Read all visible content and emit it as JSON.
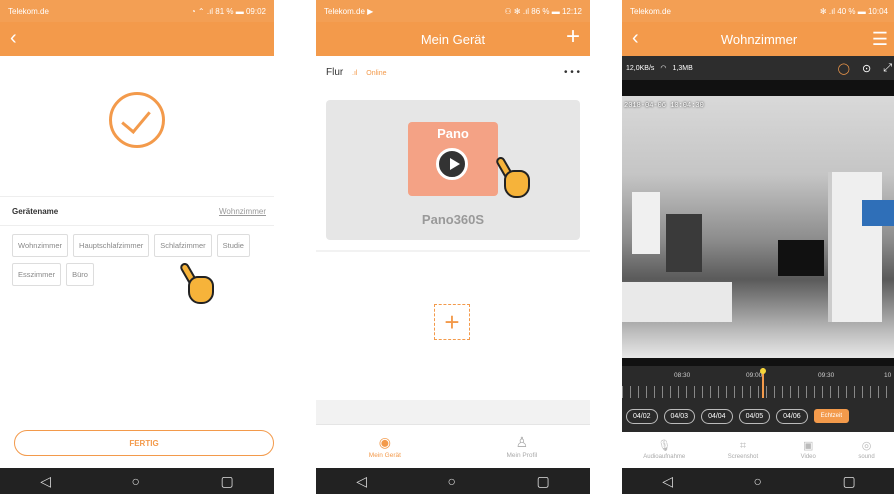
{
  "screen1": {
    "status_carrier": "Telekom.de",
    "status_right": "◔ ⌃ .ıl 81 % ▬ 09:02",
    "back_icon": "chevron-left-icon",
    "device_name_label": "Gerätename",
    "device_name_value": "Wohnzimmer",
    "room_chips": [
      "Wohnzimmer",
      "Hauptschlafzimmer",
      "Schlafzimmer",
      "Studie",
      "Esszimmer",
      "Büro"
    ],
    "finish_label": "FERTIG"
  },
  "screen2": {
    "status_carrier": "Telekom.de ▶",
    "status_right": "⚇ ✻ .ıl 86 % ▬ 12:12",
    "title": "Mein Gerät",
    "device_name": "Flur",
    "device_status": "Online",
    "more_label": "• • •",
    "logo_text": "Pano",
    "brand_text": "Pano360S",
    "add_label": "+",
    "tabs": [
      "Mein Gerät",
      "Mein Profil"
    ]
  },
  "screen3": {
    "status_carrier": "Telekom.de",
    "status_right": "✻ .ıl 40 % ▬ 10:04",
    "title": "Wohnzimmer",
    "speed": "12,0KB/s",
    "data_used": "1,3MB",
    "timestamp": "2018-04-06 10:04:30",
    "time_labels": [
      "08:30",
      "09:00",
      "09:30",
      "10"
    ],
    "dates": [
      "04/02",
      "04/03",
      "04/04",
      "04/05",
      "04/06"
    ],
    "live_label": "Echtzeit",
    "tools": [
      "Audioaufnahme",
      "Screenshot",
      "Video",
      "sound"
    ]
  },
  "nav_icons": [
    "back-triangle-icon",
    "home-circle-icon",
    "recents-square-icon"
  ],
  "colors": {
    "accent": "#f39a4b"
  }
}
